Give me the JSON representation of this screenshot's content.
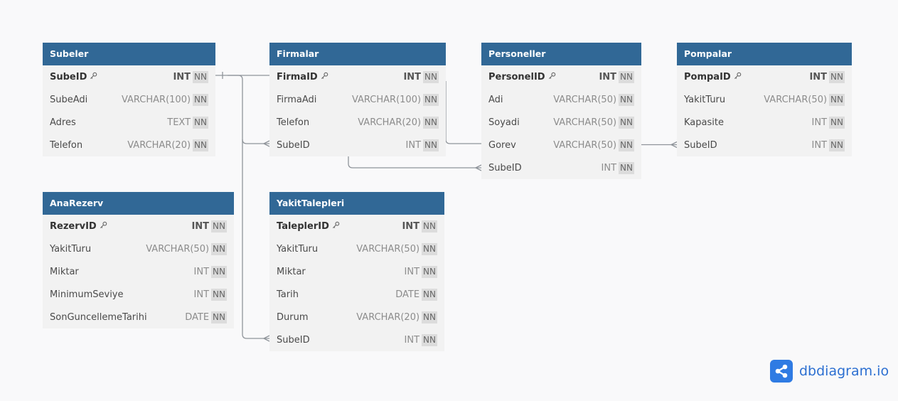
{
  "brand": {
    "name": "dbdiagram.io",
    "accent": "#2f7be3"
  },
  "colors": {
    "header": "#316896",
    "row_bg": "#f2f2f2",
    "connector": "#8f949a"
  },
  "tables": [
    {
      "name": "Subeler",
      "columns": [
        {
          "name": "SubeID",
          "type": "INT",
          "nn": "NN",
          "pk": true
        },
        {
          "name": "SubeAdi",
          "type": "VARCHAR(100)",
          "nn": "NN"
        },
        {
          "name": "Adres",
          "type": "TEXT",
          "nn": "NN"
        },
        {
          "name": "Telefon",
          "type": "VARCHAR(20)",
          "nn": "NN"
        }
      ]
    },
    {
      "name": "Firmalar",
      "columns": [
        {
          "name": "FirmaID",
          "type": "INT",
          "nn": "NN",
          "pk": true
        },
        {
          "name": "FirmaAdi",
          "type": "VARCHAR(100)",
          "nn": "NN"
        },
        {
          "name": "Telefon",
          "type": "VARCHAR(20)",
          "nn": "NN"
        },
        {
          "name": "SubeID",
          "type": "INT",
          "nn": "NN"
        }
      ]
    },
    {
      "name": "Personeller",
      "columns": [
        {
          "name": "PersonelID",
          "type": "INT",
          "nn": "NN",
          "pk": true
        },
        {
          "name": "Adi",
          "type": "VARCHAR(50)",
          "nn": "NN"
        },
        {
          "name": "Soyadi",
          "type": "VARCHAR(50)",
          "nn": "NN"
        },
        {
          "name": "Gorev",
          "type": "VARCHAR(50)",
          "nn": "NN"
        },
        {
          "name": "SubeID",
          "type": "INT",
          "nn": "NN"
        }
      ]
    },
    {
      "name": "Pompalar",
      "columns": [
        {
          "name": "PompaID",
          "type": "INT",
          "nn": "NN",
          "pk": true
        },
        {
          "name": "YakitTuru",
          "type": "VARCHAR(50)",
          "nn": "NN"
        },
        {
          "name": "Kapasite",
          "type": "INT",
          "nn": "NN"
        },
        {
          "name": "SubeID",
          "type": "INT",
          "nn": "NN"
        }
      ]
    },
    {
      "name": "AnaRezerv",
      "columns": [
        {
          "name": "RezervID",
          "type": "INT",
          "nn": "NN",
          "pk": true
        },
        {
          "name": "YakitTuru",
          "type": "VARCHAR(50)",
          "nn": "NN"
        },
        {
          "name": "Miktar",
          "type": "INT",
          "nn": "NN"
        },
        {
          "name": "MinimumSeviye",
          "type": "INT",
          "nn": "NN"
        },
        {
          "name": "SonGuncellemeTarihi",
          "type": "DATE",
          "nn": "NN"
        }
      ]
    },
    {
      "name": "YakitTalepleri",
      "columns": [
        {
          "name": "TaleplerID",
          "type": "INT",
          "nn": "NN",
          "pk": true
        },
        {
          "name": "YakitTuru",
          "type": "VARCHAR(50)",
          "nn": "NN"
        },
        {
          "name": "Miktar",
          "type": "INT",
          "nn": "NN"
        },
        {
          "name": "Tarih",
          "type": "DATE",
          "nn": "NN"
        },
        {
          "name": "Durum",
          "type": "VARCHAR(20)",
          "nn": "NN"
        },
        {
          "name": "SubeID",
          "type": "INT",
          "nn": "NN"
        }
      ]
    }
  ]
}
